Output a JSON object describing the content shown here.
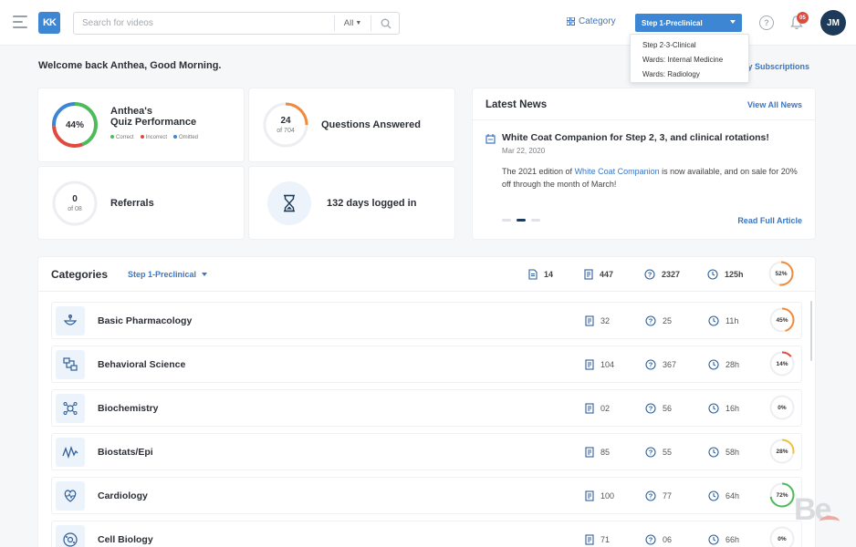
{
  "header": {
    "logo_text": "KK",
    "search_placeholder": "Search for videos",
    "search_filter": "All",
    "category_link": "Category",
    "step_select": "Step 1-Preclinical",
    "notification_count": "05",
    "avatar_initials": "JM"
  },
  "step_dropdown": {
    "options": [
      "Step 2-3-Clinical",
      "Wards: Internal Medicine",
      "Wards: Radiology"
    ]
  },
  "welcome_text": "Welcome back Anthea, Good Morning.",
  "subscriptions_link": "ly Subscriptions",
  "quiz": {
    "percent_label": "44%",
    "title_line1": "Anthea's",
    "title_line2": "Quiz Performance",
    "legend": [
      "Correct",
      "Incorrect",
      "Omitted"
    ],
    "colors": [
      "#4cbb5a",
      "#e04b3f",
      "#3d86d4"
    ],
    "breakdown": {
      "correct": 0.44,
      "incorrect": 0.3,
      "omitted": 0.26
    }
  },
  "questions": {
    "count": "24",
    "total": "of 704",
    "label": "Questions Answered",
    "fraction": 0.25,
    "color": "#f08a3c"
  },
  "referrals": {
    "count": "0",
    "total": "of 08",
    "label": "Referrals"
  },
  "logged": {
    "label": "132 days logged in"
  },
  "news": {
    "title": "Latest News",
    "view_all": "View All News",
    "headline": "White Coat Companion for Step 2, 3, and clinical rotations!",
    "date": "Mar 22, 2020",
    "body_before": "The 2021 edition of ",
    "body_link": "White Coat Companion",
    "body_after": " is now available, and on sale for 20% off through the month of March!",
    "read_more": "Read Full Article"
  },
  "categories": {
    "title": "Categories",
    "filter": "Step 1-Preclinical",
    "totals": {
      "docs": "14",
      "notes": "447",
      "questions": "2327",
      "time": "125h",
      "percent": "52%",
      "fraction": 0.52,
      "color": "#f08a3c"
    },
    "rows": [
      {
        "name": "Basic Pharmacology",
        "icon": "pharmacology-icon",
        "notes": "32",
        "questions": "25",
        "time": "11h",
        "percent": "45%",
        "fraction": 0.45,
        "color": "#f08a3c"
      },
      {
        "name": "Behavioral Science",
        "icon": "behavioral-icon",
        "notes": "104",
        "questions": "367",
        "time": "28h",
        "percent": "14%",
        "fraction": 0.14,
        "color": "#e04b3f"
      },
      {
        "name": "Biochemistry",
        "icon": "biochemistry-icon",
        "notes": "02",
        "questions": "56",
        "time": "16h",
        "percent": "0%",
        "fraction": 0,
        "color": "#e04b3f"
      },
      {
        "name": "Biostats/Epi",
        "icon": "biostats-icon",
        "notes": "85",
        "questions": "55",
        "time": "58h",
        "percent": "28%",
        "fraction": 0.28,
        "color": "#f0c03c"
      },
      {
        "name": "Cardiology",
        "icon": "cardiology-icon",
        "notes": "100",
        "questions": "77",
        "time": "64h",
        "percent": "72%",
        "fraction": 0.72,
        "color": "#4cbb5a"
      },
      {
        "name": "Cell Biology",
        "icon": "cell-biology-icon",
        "notes": "71",
        "questions": "06",
        "time": "66h",
        "percent": "0%",
        "fraction": 0,
        "color": "#e04b3f"
      }
    ]
  },
  "watermark": "Be"
}
